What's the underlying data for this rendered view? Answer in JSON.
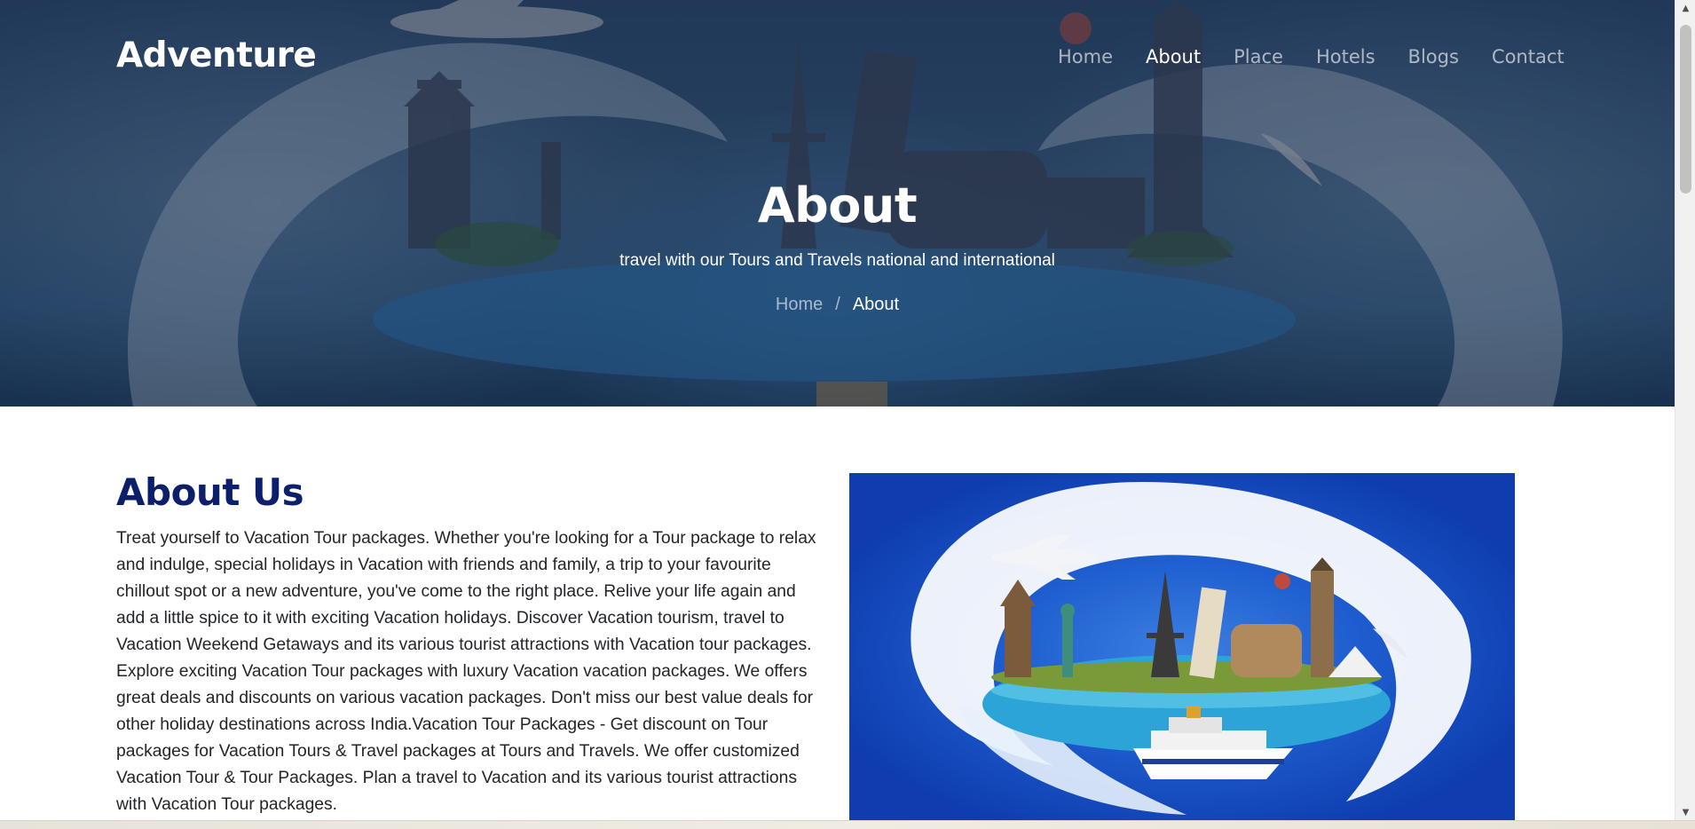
{
  "header": {
    "brand": "Adventure",
    "nav": [
      {
        "label": "Home",
        "active": false
      },
      {
        "label": "About",
        "active": true
      },
      {
        "label": "Place",
        "active": false
      },
      {
        "label": "Hotels",
        "active": false
      },
      {
        "label": "Blogs",
        "active": false
      },
      {
        "label": "Contact",
        "active": false
      }
    ]
  },
  "hero": {
    "title": "About",
    "subtitle": "travel with our Tours and Travels national and international",
    "breadcrumb": {
      "home": "Home",
      "separator": "/",
      "current": "About"
    }
  },
  "about": {
    "heading": "About Us",
    "body": "Treat yourself to Vacation Tour packages. Whether you're looking for a Tour package to relax and indulge, special holidays in Vacation with friends and family, a trip to your favourite chillout spot or a new adventure, you've come to the right place. Relive your life again and add a little spice to it with exciting Vacation holidays. Discover Vacation tourism, travel to Vacation Weekend Getaways and its various tourist attractions with Vacation tour packages. Explore exciting Vacation Tour packages with luxury Vacation vacation packages. We offers great deals and discounts on various vacation packages. Don't miss our best value deals for other holiday destinations across India.Vacation Tour Packages - Get discount on Tour packages for Vacation Tours & Travel packages at Tours and Travels. We offer customized Vacation Tour & Tour Packages. Plan a travel to Vacation and its various tourist attractions with Vacation Tour packages."
  },
  "colors": {
    "brand_heading": "#0b1f6a",
    "nav_active": "#ffffff",
    "hero_overlay": "#161e34"
  },
  "icons": {
    "scroll_up": "scroll-up-arrow-icon",
    "scroll_down": "scroll-down-arrow-icon"
  }
}
